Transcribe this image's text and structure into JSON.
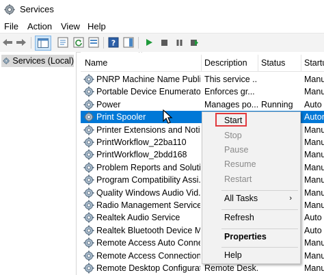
{
  "window": {
    "title": "Services"
  },
  "menu": [
    "File",
    "Action",
    "View",
    "Help"
  ],
  "toolbar": {
    "icons": [
      "back-arrow-icon",
      "forward-arrow-icon",
      "console-tree-icon",
      "properties-icon",
      "refresh-icon",
      "export-list-icon",
      "help-icon",
      "show-hide-icon",
      "play-icon",
      "stop-icon",
      "pause-icon",
      "restart-icon"
    ]
  },
  "tree": {
    "item": "Services (Local)"
  },
  "columns": {
    "name": "Name",
    "description": "Description",
    "status": "Status",
    "startup": "Startup"
  },
  "rows": [
    {
      "name": "PNRP Machine Name Publi...",
      "description": "This service ...",
      "status": "",
      "startup": "Manu"
    },
    {
      "name": "Portable Device Enumerator...",
      "description": "Enforces gr...",
      "status": "",
      "startup": "Manu"
    },
    {
      "name": "Power",
      "description": "Manages po...",
      "status": "Running",
      "startup": "Auto"
    },
    {
      "name": "Print Spooler",
      "description": "",
      "status": "",
      "startup": "Autor"
    },
    {
      "name": "Printer Extensions and Notif...",
      "description": "",
      "status": "",
      "startup": "Manu"
    },
    {
      "name": "PrintWorkflow_22ba110",
      "description": "",
      "status": "",
      "startup": "Manu"
    },
    {
      "name": "PrintWorkflow_2bdd168",
      "description": "",
      "status": "",
      "startup": "Manu"
    },
    {
      "name": "Problem Reports and Soluti...",
      "description": "",
      "status": "",
      "startup": "Manu"
    },
    {
      "name": "Program Compatibility Assi...",
      "description": "",
      "status": "",
      "startup": "Manu"
    },
    {
      "name": "Quality Windows Audio Vid...",
      "description": "",
      "status": "",
      "startup": "Manu"
    },
    {
      "name": "Radio Management Service",
      "description": "",
      "status": "",
      "startup": "Manu"
    },
    {
      "name": "Realtek Audio Service",
      "description": "",
      "status": "",
      "startup": "Auto"
    },
    {
      "name": "Realtek Bluetooth Device M...",
      "description": "",
      "status": "",
      "startup": "Auto"
    },
    {
      "name": "Remote Access Auto Conne...",
      "description": "",
      "status": "",
      "startup": "Manu"
    },
    {
      "name": "Remote Access Connection...",
      "description": "",
      "status": "",
      "startup": "Manu"
    },
    {
      "name": "Remote Desktop Configurat...",
      "description": "Remote Desk...",
      "status": "",
      "startup": "Manu"
    }
  ],
  "context_menu": {
    "start": "Start",
    "stop": "Stop",
    "pause": "Pause",
    "resume": "Resume",
    "restart": "Restart",
    "all_tasks": "All Tasks",
    "refresh": "Refresh",
    "properties": "Properties",
    "help": "Help"
  },
  "colors": {
    "selection": "#0078d7",
    "highlight_box": "#e0383d",
    "menu_bg": "#f2f2f2"
  }
}
